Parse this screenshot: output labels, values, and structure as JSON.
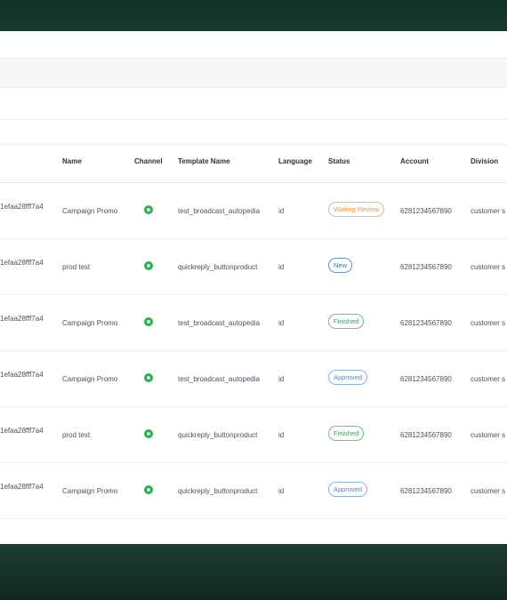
{
  "columns": {
    "name": "Name",
    "channel": "Channel",
    "template_name": "Template Name",
    "language": "Language",
    "status": "Status",
    "account": "Account",
    "division": "Division"
  },
  "channel_icon": "whatsapp-icon",
  "status_colors": {
    "Waiting Review": "#f29a3f",
    "New": "#2e78c8",
    "Finished": "#34a853",
    "Approved": "#4b8ad0"
  },
  "rows": [
    {
      "id": "1efaa28fff7a4",
      "name": "Campaign Promo",
      "template": "test_broadcast_autopedia",
      "language": "id",
      "status": "Waiting Review",
      "account": "6281234567890",
      "division": "customer s"
    },
    {
      "id": "1efaa28fff7a4",
      "name": "prod test",
      "template": "quickreply_buttonproduct",
      "language": "id",
      "status": "New",
      "account": "6281234567890",
      "division": "customer s"
    },
    {
      "id": "1efaa28fff7a4",
      "name": "Campaign Promo",
      "template": "test_broadcast_autopedia",
      "language": "id",
      "status": "Finished",
      "account": "6281234567890",
      "division": "customer s"
    },
    {
      "id": "1efaa28fff7a4",
      "name": "Campaign Promo",
      "template": "test_broadcast_autopedia",
      "language": "id",
      "status": "Approved",
      "account": "6281234567890",
      "division": "customer s"
    },
    {
      "id": "1efaa28fff7a4",
      "name": "prod test",
      "template": "quickreply_buttonproduct",
      "language": "id",
      "status": "Finished",
      "account": "6281234567890",
      "division": "customer s"
    },
    {
      "id": "1efaa28fff7a4",
      "name": "Campaign Promo",
      "template": "quickreply_buttonproduct",
      "language": "id",
      "status": "Approved",
      "account": "6281234567890",
      "division": "customer s"
    }
  ]
}
